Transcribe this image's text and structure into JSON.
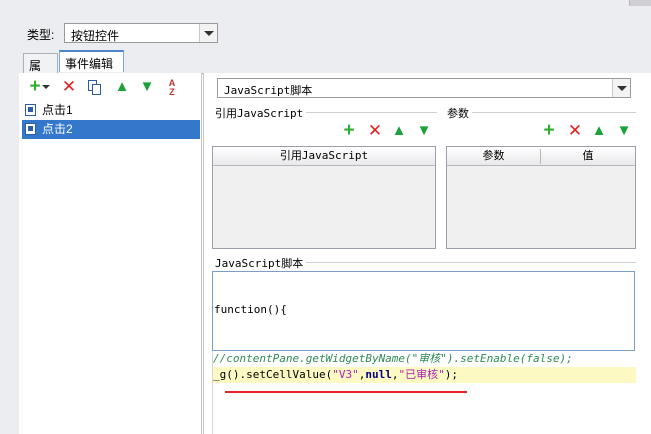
{
  "type_row": {
    "label": "类型:",
    "value": "按钮控件"
  },
  "tabs": [
    {
      "label": "属性"
    },
    {
      "label": "事件编辑"
    }
  ],
  "events": [
    {
      "label": "点击1"
    },
    {
      "label": "点击2"
    }
  ],
  "script_type": "JavaScript脚本",
  "ref_group": {
    "title": "引用JavaScript",
    "column": "引用JavaScript"
  },
  "params_group": {
    "title": "参数",
    "columns": [
      "参数",
      "值"
    ]
  },
  "script_group": {
    "title": "JavaScript脚本"
  },
  "code": {
    "header": "function(){",
    "comment": "//contentPane.getWidgetByName(\"审核\").setEnable(false);",
    "line2_prefix": "_g().setCellValue(",
    "line2_arg1": "\"V3\"",
    "line2_comma1": ",",
    "line2_null": "null",
    "line2_comma2": ",",
    "line2_arg3": "\"已审核\"",
    "line2_suffix": ");"
  },
  "colors": {
    "selection": "#3478cc",
    "add": "#2fae2f",
    "delete": "#e02020",
    "annotation": "#e8242a"
  }
}
